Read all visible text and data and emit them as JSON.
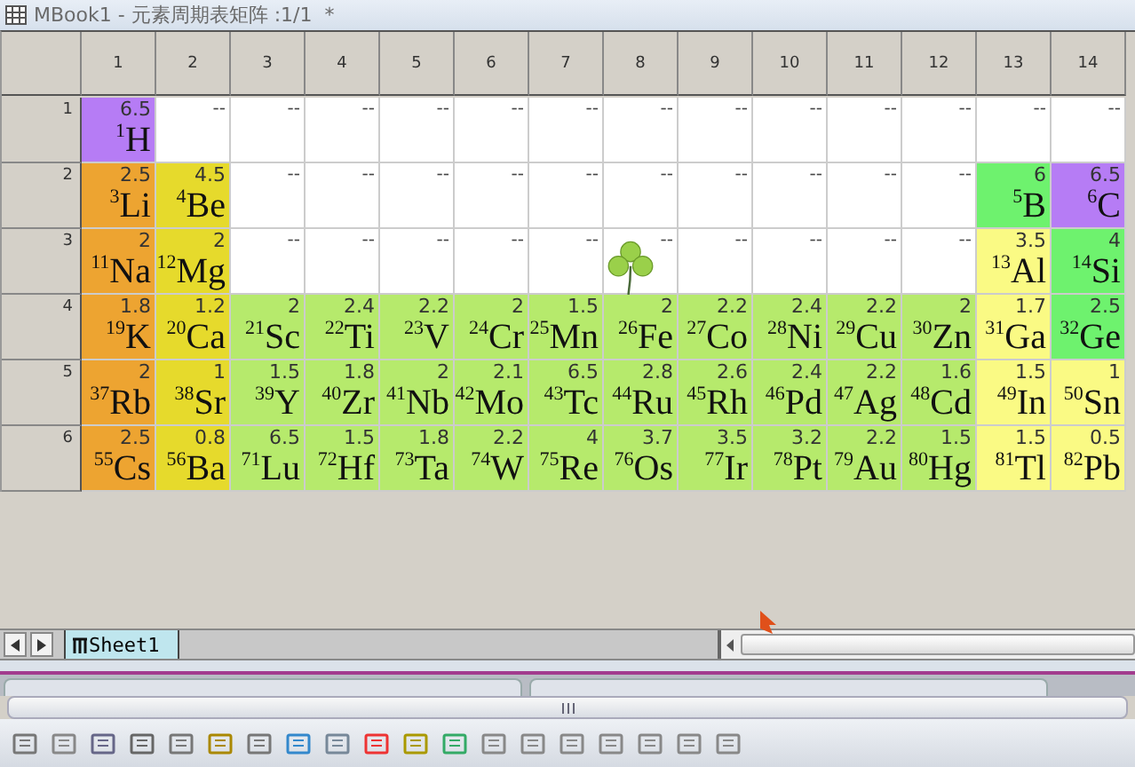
{
  "window": {
    "title": "MBook1 - 元素周期表矩阵 :1/1  *"
  },
  "columns": [
    "1",
    "2",
    "3",
    "4",
    "5",
    "6",
    "7",
    "8",
    "9",
    "10",
    "11",
    "12",
    "13",
    "14"
  ],
  "rows": [
    {
      "header": "1",
      "cells": [
        {
          "kind": "element",
          "value": "6.5",
          "number": "1",
          "symbol": "H",
          "color": "#b67cf5"
        },
        {
          "kind": "empty",
          "value": "--"
        },
        {
          "kind": "empty",
          "value": "--"
        },
        {
          "kind": "empty",
          "value": "--"
        },
        {
          "kind": "empty",
          "value": "--"
        },
        {
          "kind": "empty",
          "value": "--"
        },
        {
          "kind": "empty",
          "value": "--"
        },
        {
          "kind": "empty",
          "value": "--"
        },
        {
          "kind": "empty",
          "value": "--"
        },
        {
          "kind": "empty",
          "value": "--"
        },
        {
          "kind": "empty",
          "value": "--"
        },
        {
          "kind": "empty",
          "value": "--"
        },
        {
          "kind": "empty",
          "value": "--"
        },
        {
          "kind": "empty",
          "value": "--"
        }
      ]
    },
    {
      "header": "2",
      "cells": [
        {
          "kind": "element",
          "value": "2.5",
          "number": "3",
          "symbol": "Li",
          "color": "#eda431"
        },
        {
          "kind": "element",
          "value": "4.5",
          "number": "4",
          "symbol": "Be",
          "color": "#e6da2c"
        },
        {
          "kind": "empty",
          "value": "--"
        },
        {
          "kind": "empty",
          "value": "--"
        },
        {
          "kind": "empty",
          "value": "--"
        },
        {
          "kind": "empty",
          "value": "--"
        },
        {
          "kind": "empty",
          "value": "--"
        },
        {
          "kind": "empty",
          "value": "--"
        },
        {
          "kind": "empty",
          "value": "--"
        },
        {
          "kind": "empty",
          "value": "--"
        },
        {
          "kind": "empty",
          "value": "--"
        },
        {
          "kind": "empty",
          "value": "--"
        },
        {
          "kind": "element",
          "value": "6",
          "number": "5",
          "symbol": "B",
          "color": "#6ef26e"
        },
        {
          "kind": "element",
          "value": "6.5",
          "number": "6",
          "symbol": "C",
          "color": "#b67cf5"
        }
      ]
    },
    {
      "header": "3",
      "cells": [
        {
          "kind": "element",
          "value": "2",
          "number": "11",
          "symbol": "Na",
          "color": "#eda431"
        },
        {
          "kind": "element",
          "value": "2",
          "number": "12",
          "symbol": "Mg",
          "color": "#e6da2c"
        },
        {
          "kind": "empty",
          "value": "--"
        },
        {
          "kind": "empty",
          "value": "--"
        },
        {
          "kind": "empty",
          "value": "--"
        },
        {
          "kind": "empty",
          "value": "--"
        },
        {
          "kind": "empty",
          "value": "--"
        },
        {
          "kind": "empty",
          "value": "--"
        },
        {
          "kind": "empty",
          "value": "--"
        },
        {
          "kind": "empty",
          "value": "--"
        },
        {
          "kind": "empty",
          "value": "--"
        },
        {
          "kind": "empty",
          "value": "--"
        },
        {
          "kind": "element",
          "value": "3.5",
          "number": "13",
          "symbol": "Al",
          "color": "#fafa84"
        },
        {
          "kind": "element",
          "value": "4",
          "number": "14",
          "symbol": "Si",
          "color": "#6ef26e"
        }
      ]
    },
    {
      "header": "4",
      "cells": [
        {
          "kind": "element",
          "value": "1.8",
          "number": "19",
          "symbol": "K",
          "color": "#eda431"
        },
        {
          "kind": "element",
          "value": "1.2",
          "number": "20",
          "symbol": "Ca",
          "color": "#e6da2c"
        },
        {
          "kind": "element",
          "value": "2",
          "number": "21",
          "symbol": "Sc",
          "color": "#b6ea6c"
        },
        {
          "kind": "element",
          "value": "2.4",
          "number": "22",
          "symbol": "Ti",
          "color": "#b6ea6c"
        },
        {
          "kind": "element",
          "value": "2.2",
          "number": "23",
          "symbol": "V",
          "color": "#b6ea6c"
        },
        {
          "kind": "element",
          "value": "2",
          "number": "24",
          "symbol": "Cr",
          "color": "#b6ea6c"
        },
        {
          "kind": "element",
          "value": "1.5",
          "number": "25",
          "symbol": "Mn",
          "color": "#b6ea6c"
        },
        {
          "kind": "element",
          "value": "2",
          "number": "26",
          "symbol": "Fe",
          "color": "#b6ea6c"
        },
        {
          "kind": "element",
          "value": "2.2",
          "number": "27",
          "symbol": "Co",
          "color": "#b6ea6c"
        },
        {
          "kind": "element",
          "value": "2.4",
          "number": "28",
          "symbol": "Ni",
          "color": "#b6ea6c"
        },
        {
          "kind": "element",
          "value": "2.2",
          "number": "29",
          "symbol": "Cu",
          "color": "#b6ea6c"
        },
        {
          "kind": "element",
          "value": "2",
          "number": "30",
          "symbol": "Zn",
          "color": "#b6ea6c"
        },
        {
          "kind": "element",
          "value": "1.7",
          "number": "31",
          "symbol": "Ga",
          "color": "#fafa84"
        },
        {
          "kind": "element",
          "value": "2.5",
          "number": "32",
          "symbol": "Ge",
          "color": "#6ef26e"
        }
      ]
    },
    {
      "header": "5",
      "cells": [
        {
          "kind": "element",
          "value": "2",
          "number": "37",
          "symbol": "Rb",
          "color": "#eda431"
        },
        {
          "kind": "element",
          "value": "1",
          "number": "38",
          "symbol": "Sr",
          "color": "#e6da2c"
        },
        {
          "kind": "element",
          "value": "1.5",
          "number": "39",
          "symbol": "Y",
          "color": "#b6ea6c"
        },
        {
          "kind": "element",
          "value": "1.8",
          "number": "40",
          "symbol": "Zr",
          "color": "#b6ea6c"
        },
        {
          "kind": "element",
          "value": "2",
          "number": "41",
          "symbol": "Nb",
          "color": "#b6ea6c"
        },
        {
          "kind": "element",
          "value": "2.1",
          "number": "42",
          "symbol": "Mo",
          "color": "#b6ea6c"
        },
        {
          "kind": "element",
          "value": "6.5",
          "number": "43",
          "symbol": "Tc",
          "color": "#b6ea6c"
        },
        {
          "kind": "element",
          "value": "2.8",
          "number": "44",
          "symbol": "Ru",
          "color": "#b6ea6c"
        },
        {
          "kind": "element",
          "value": "2.6",
          "number": "45",
          "symbol": "Rh",
          "color": "#b6ea6c"
        },
        {
          "kind": "element",
          "value": "2.4",
          "number": "46",
          "symbol": "Pd",
          "color": "#b6ea6c"
        },
        {
          "kind": "element",
          "value": "2.2",
          "number": "47",
          "symbol": "Ag",
          "color": "#b6ea6c"
        },
        {
          "kind": "element",
          "value": "1.6",
          "number": "48",
          "symbol": "Cd",
          "color": "#b6ea6c"
        },
        {
          "kind": "element",
          "value": "1.5",
          "number": "49",
          "symbol": "In",
          "color": "#fafa84"
        },
        {
          "kind": "element",
          "value": "1",
          "number": "50",
          "symbol": "Sn",
          "color": "#fafa84"
        }
      ]
    },
    {
      "header": "6",
      "cells": [
        {
          "kind": "element",
          "value": "2.5",
          "number": "55",
          "symbol": "Cs",
          "color": "#eda431"
        },
        {
          "kind": "element",
          "value": "0.8",
          "number": "56",
          "symbol": "Ba",
          "color": "#e6da2c"
        },
        {
          "kind": "element",
          "value": "6.5",
          "number": "71",
          "symbol": "Lu",
          "color": "#b6ea6c"
        },
        {
          "kind": "element",
          "value": "1.5",
          "number": "72",
          "symbol": "Hf",
          "color": "#b6ea6c"
        },
        {
          "kind": "element",
          "value": "1.8",
          "number": "73",
          "symbol": "Ta",
          "color": "#b6ea6c"
        },
        {
          "kind": "element",
          "value": "2.2",
          "number": "74",
          "symbol": "W",
          "color": "#b6ea6c"
        },
        {
          "kind": "element",
          "value": "4",
          "number": "75",
          "symbol": "Re",
          "color": "#b6ea6c"
        },
        {
          "kind": "element",
          "value": "3.7",
          "number": "76",
          "symbol": "Os",
          "color": "#b6ea6c"
        },
        {
          "kind": "element",
          "value": "3.5",
          "number": "77",
          "symbol": "Ir",
          "color": "#b6ea6c"
        },
        {
          "kind": "element",
          "value": "3.2",
          "number": "78",
          "symbol": "Pt",
          "color": "#b6ea6c"
        },
        {
          "kind": "element",
          "value": "2.2",
          "number": "79",
          "symbol": "Au",
          "color": "#b6ea6c"
        },
        {
          "kind": "element",
          "value": "1.5",
          "number": "80",
          "symbol": "Hg",
          "color": "#b6ea6c"
        },
        {
          "kind": "element",
          "value": "1.5",
          "number": "81",
          "symbol": "Tl",
          "color": "#fafa84"
        },
        {
          "kind": "element",
          "value": "0.5",
          "number": "82",
          "symbol": "Pb",
          "color": "#fafa84"
        }
      ]
    }
  ],
  "sheet_tabs": [
    {
      "label": "Sheet1",
      "selected": true
    }
  ]
}
